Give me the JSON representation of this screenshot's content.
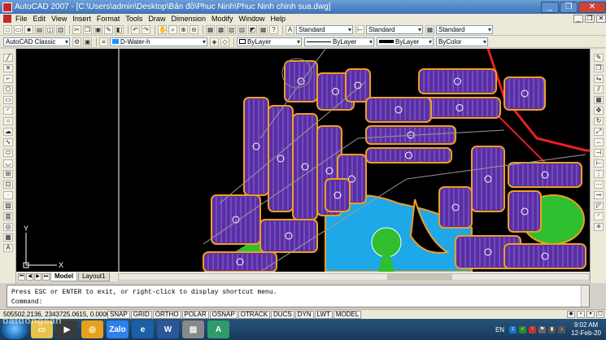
{
  "window": {
    "title": "AutoCAD 2007 - [C:\\Users\\admin\\Desktop\\Bản đồ\\Phuc Ninh\\Phuc Ninh chinh sua.dwg]",
    "buttons": {
      "minimize": "_",
      "restore": "❐",
      "close": "✕"
    }
  },
  "menu": {
    "items": [
      "File",
      "Edit",
      "View",
      "Insert",
      "Format",
      "Tools",
      "Draw",
      "Dimension",
      "Modify",
      "Window",
      "Help"
    ],
    "mdi": {
      "minimize": "_",
      "restore": "❐",
      "close": "✕"
    }
  },
  "toolbar1": {
    "text_style": "Standard",
    "dim_style": "Standard",
    "table_style": "Standard"
  },
  "toolbar2": {
    "workspace": "AutoCAD Classic",
    "layer": "D-Water-h",
    "color": "ByLayer",
    "linetype": "ByLayer",
    "lineweight": "ByLayer",
    "plotstyle": "ByColor",
    "colors": {
      "layer_swatch": "#1e90ff",
      "lineweight_swatch": "#000000"
    }
  },
  "canvas": {
    "ucs": {
      "x_label": "X",
      "y_label": "Y"
    },
    "colors": {
      "background": "#000000",
      "road_outline": "#f0a020",
      "block": "#5a2ea8",
      "lot_line": "#ffffff",
      "lake": "#1fa8e8",
      "park": "#2fbf2f",
      "boundary": "#e82020",
      "road_center": "#9a9a9a"
    }
  },
  "layout_tabs": {
    "tabs": [
      "Model",
      "Layout1"
    ],
    "active": "Model"
  },
  "command": {
    "history": "Press ESC or ENTER to exit, or right-click to display shortcut menu.",
    "prompt": "Command:"
  },
  "status": {
    "coordinates": "505502.2136, 2343725.0615, 0.0000",
    "toggles": [
      "SNAP",
      "GRID",
      "ORTHO",
      "POLAR",
      "OSNAP",
      "OTRACK",
      "DUCS",
      "DYN",
      "LWT",
      "MODEL"
    ]
  },
  "taskbar": {
    "apps": [
      {
        "name": "Zalo",
        "label": "Zalo",
        "color": "#2f80ed"
      },
      {
        "name": "Word",
        "label": "W",
        "color": "#2b579a"
      },
      {
        "name": "AutoCAD",
        "label": "A",
        "color": "#2e9c6a"
      }
    ],
    "language": "EN",
    "time": "9:02 AM",
    "date": "12-Feb-20"
  },
  "watermark": "batdongsan"
}
